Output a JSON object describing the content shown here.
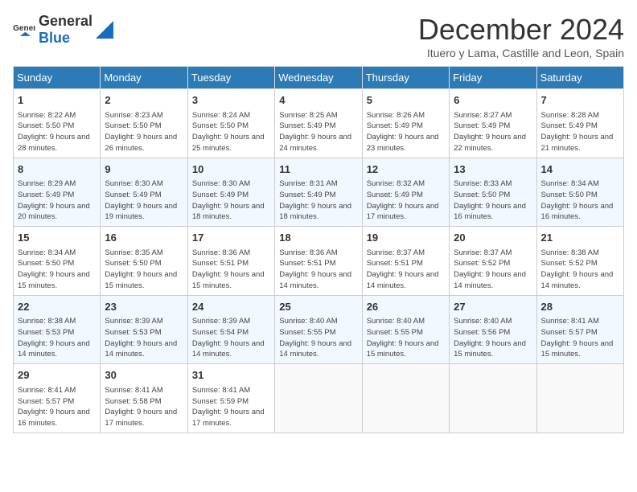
{
  "header": {
    "logo_general": "General",
    "logo_blue": "Blue",
    "month_title": "December 2024",
    "subtitle": "Ituero y Lama, Castille and Leon, Spain"
  },
  "weekdays": [
    "Sunday",
    "Monday",
    "Tuesday",
    "Wednesday",
    "Thursday",
    "Friday",
    "Saturday"
  ],
  "weeks": [
    [
      {
        "day": "1",
        "sunrise": "8:22 AM",
        "sunset": "5:50 PM",
        "daylight": "9 hours and 28 minutes."
      },
      {
        "day": "2",
        "sunrise": "8:23 AM",
        "sunset": "5:50 PM",
        "daylight": "9 hours and 26 minutes."
      },
      {
        "day": "3",
        "sunrise": "8:24 AM",
        "sunset": "5:50 PM",
        "daylight": "9 hours and 25 minutes."
      },
      {
        "day": "4",
        "sunrise": "8:25 AM",
        "sunset": "5:49 PM",
        "daylight": "9 hours and 24 minutes."
      },
      {
        "day": "5",
        "sunrise": "8:26 AM",
        "sunset": "5:49 PM",
        "daylight": "9 hours and 23 minutes."
      },
      {
        "day": "6",
        "sunrise": "8:27 AM",
        "sunset": "5:49 PM",
        "daylight": "9 hours and 22 minutes."
      },
      {
        "day": "7",
        "sunrise": "8:28 AM",
        "sunset": "5:49 PM",
        "daylight": "9 hours and 21 minutes."
      }
    ],
    [
      {
        "day": "8",
        "sunrise": "8:29 AM",
        "sunset": "5:49 PM",
        "daylight": "9 hours and 20 minutes."
      },
      {
        "day": "9",
        "sunrise": "8:30 AM",
        "sunset": "5:49 PM",
        "daylight": "9 hours and 19 minutes."
      },
      {
        "day": "10",
        "sunrise": "8:30 AM",
        "sunset": "5:49 PM",
        "daylight": "9 hours and 18 minutes."
      },
      {
        "day": "11",
        "sunrise": "8:31 AM",
        "sunset": "5:49 PM",
        "daylight": "9 hours and 18 minutes."
      },
      {
        "day": "12",
        "sunrise": "8:32 AM",
        "sunset": "5:49 PM",
        "daylight": "9 hours and 17 minutes."
      },
      {
        "day": "13",
        "sunrise": "8:33 AM",
        "sunset": "5:50 PM",
        "daylight": "9 hours and 16 minutes."
      },
      {
        "day": "14",
        "sunrise": "8:34 AM",
        "sunset": "5:50 PM",
        "daylight": "9 hours and 16 minutes."
      }
    ],
    [
      {
        "day": "15",
        "sunrise": "8:34 AM",
        "sunset": "5:50 PM",
        "daylight": "9 hours and 15 minutes."
      },
      {
        "day": "16",
        "sunrise": "8:35 AM",
        "sunset": "5:50 PM",
        "daylight": "9 hours and 15 minutes."
      },
      {
        "day": "17",
        "sunrise": "8:36 AM",
        "sunset": "5:51 PM",
        "daylight": "9 hours and 15 minutes."
      },
      {
        "day": "18",
        "sunrise": "8:36 AM",
        "sunset": "5:51 PM",
        "daylight": "9 hours and 14 minutes."
      },
      {
        "day": "19",
        "sunrise": "8:37 AM",
        "sunset": "5:51 PM",
        "daylight": "9 hours and 14 minutes."
      },
      {
        "day": "20",
        "sunrise": "8:37 AM",
        "sunset": "5:52 PM",
        "daylight": "9 hours and 14 minutes."
      },
      {
        "day": "21",
        "sunrise": "8:38 AM",
        "sunset": "5:52 PM",
        "daylight": "9 hours and 14 minutes."
      }
    ],
    [
      {
        "day": "22",
        "sunrise": "8:38 AM",
        "sunset": "5:53 PM",
        "daylight": "9 hours and 14 minutes."
      },
      {
        "day": "23",
        "sunrise": "8:39 AM",
        "sunset": "5:53 PM",
        "daylight": "9 hours and 14 minutes."
      },
      {
        "day": "24",
        "sunrise": "8:39 AM",
        "sunset": "5:54 PM",
        "daylight": "9 hours and 14 minutes."
      },
      {
        "day": "25",
        "sunrise": "8:40 AM",
        "sunset": "5:55 PM",
        "daylight": "9 hours and 14 minutes."
      },
      {
        "day": "26",
        "sunrise": "8:40 AM",
        "sunset": "5:55 PM",
        "daylight": "9 hours and 15 minutes."
      },
      {
        "day": "27",
        "sunrise": "8:40 AM",
        "sunset": "5:56 PM",
        "daylight": "9 hours and 15 minutes."
      },
      {
        "day": "28",
        "sunrise": "8:41 AM",
        "sunset": "5:57 PM",
        "daylight": "9 hours and 15 minutes."
      }
    ],
    [
      {
        "day": "29",
        "sunrise": "8:41 AM",
        "sunset": "5:57 PM",
        "daylight": "9 hours and 16 minutes."
      },
      {
        "day": "30",
        "sunrise": "8:41 AM",
        "sunset": "5:58 PM",
        "daylight": "9 hours and 17 minutes."
      },
      {
        "day": "31",
        "sunrise": "8:41 AM",
        "sunset": "5:59 PM",
        "daylight": "9 hours and 17 minutes."
      },
      null,
      null,
      null,
      null
    ]
  ]
}
